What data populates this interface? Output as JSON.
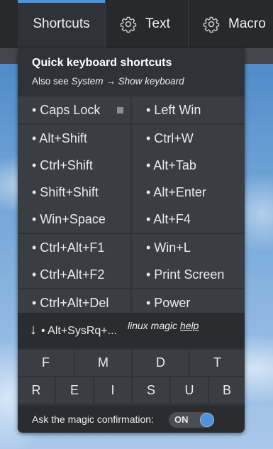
{
  "tabs": {
    "shortcuts": "Shortcuts",
    "text": "Text",
    "macro": "Macro"
  },
  "header": {
    "title": "Quick keyboard shortcuts",
    "subtitle_prefix": "Also see ",
    "subtitle_system": "System",
    "subtitle_arrow": " → ",
    "subtitle_show": "Show keyboard"
  },
  "shortcuts": [
    [
      "• Caps Lock",
      "• Left Win"
    ],
    [
      "• Alt+Shift",
      "• Ctrl+W"
    ],
    [
      "• Ctrl+Shift",
      "• Alt+Tab"
    ],
    [
      "• Shift+Shift",
      "• Alt+Enter"
    ],
    [
      "• Win+Space",
      "• Alt+F4"
    ],
    [
      "• Ctrl+Alt+F1",
      "• Win+L"
    ],
    [
      "• Ctrl+Alt+F2",
      "• Print Screen"
    ],
    [
      "• Ctrl+Alt+Del",
      "• Power"
    ]
  ],
  "magic": {
    "arrow": "↓",
    "label": "• Alt+SysRq+...",
    "note": "linux magic ",
    "help": "help"
  },
  "magic_keys_row1": [
    "F",
    "M",
    "D",
    "T"
  ],
  "magic_keys_row2": [
    "R",
    "E",
    "I",
    "S",
    "U",
    "B"
  ],
  "confirm": {
    "label": "Ask the magic confirmation:",
    "toggle": "ON"
  },
  "colors": {
    "accent": "#4d92dc",
    "panel": "#2f3237",
    "cell": "#3a3d42"
  },
  "icons": {
    "text_tab": "gear-icon",
    "macro_tab": "gear-icon"
  }
}
